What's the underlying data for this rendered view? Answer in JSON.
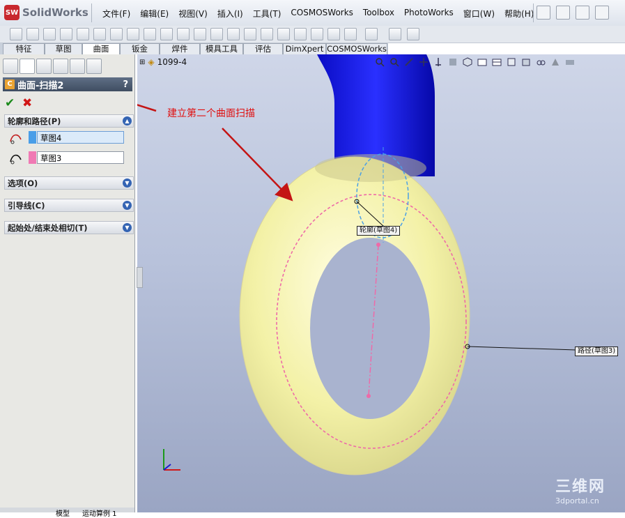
{
  "app": {
    "name": "SolidWorks",
    "logo_badge": "SW"
  },
  "menu": [
    "文件(F)",
    "编辑(E)",
    "视图(V)",
    "插入(I)",
    "工具(T)",
    "COSMOSWorks",
    "Toolbox",
    "PhotoWorks",
    "窗口(W)",
    "帮助(H)"
  ],
  "tabs": [
    {
      "label": "特征"
    },
    {
      "label": "草图"
    },
    {
      "label": "曲面",
      "active": true
    },
    {
      "label": "钣金"
    },
    {
      "label": "焊件"
    },
    {
      "label": "模具工具"
    },
    {
      "label": "评估"
    },
    {
      "label": "DimXpert"
    },
    {
      "label": "COSMOSWorks"
    }
  ],
  "panel": {
    "feature_title": "曲面-扫描2",
    "help": "?",
    "ok": "✔",
    "cancel": "✖",
    "sections": {
      "profile_path": "轮廓和路径(P)",
      "options": "选项(O)",
      "guides": "引导线(C)",
      "tangency": "起始处/结束处相切(T)"
    },
    "profile_field": {
      "value": "草图4",
      "color": "#4a9ee8"
    },
    "path_field": {
      "value": "草图3",
      "color": "#f07ab4"
    }
  },
  "viewport": {
    "tree_label": "1099-4",
    "annotation": "建立第二个曲面扫描",
    "profile_callout": "轮廓(草图4)",
    "path_callout": "路径(草图3)",
    "torus_color": "#f3f1a6",
    "pipe_color": "#1418e8",
    "arrow_color": "#c41414"
  },
  "bottom_tabs": [
    "模型",
    "运动算例 1"
  ],
  "watermark": {
    "line1": "三维网",
    "line2": "3dportal.cn"
  }
}
